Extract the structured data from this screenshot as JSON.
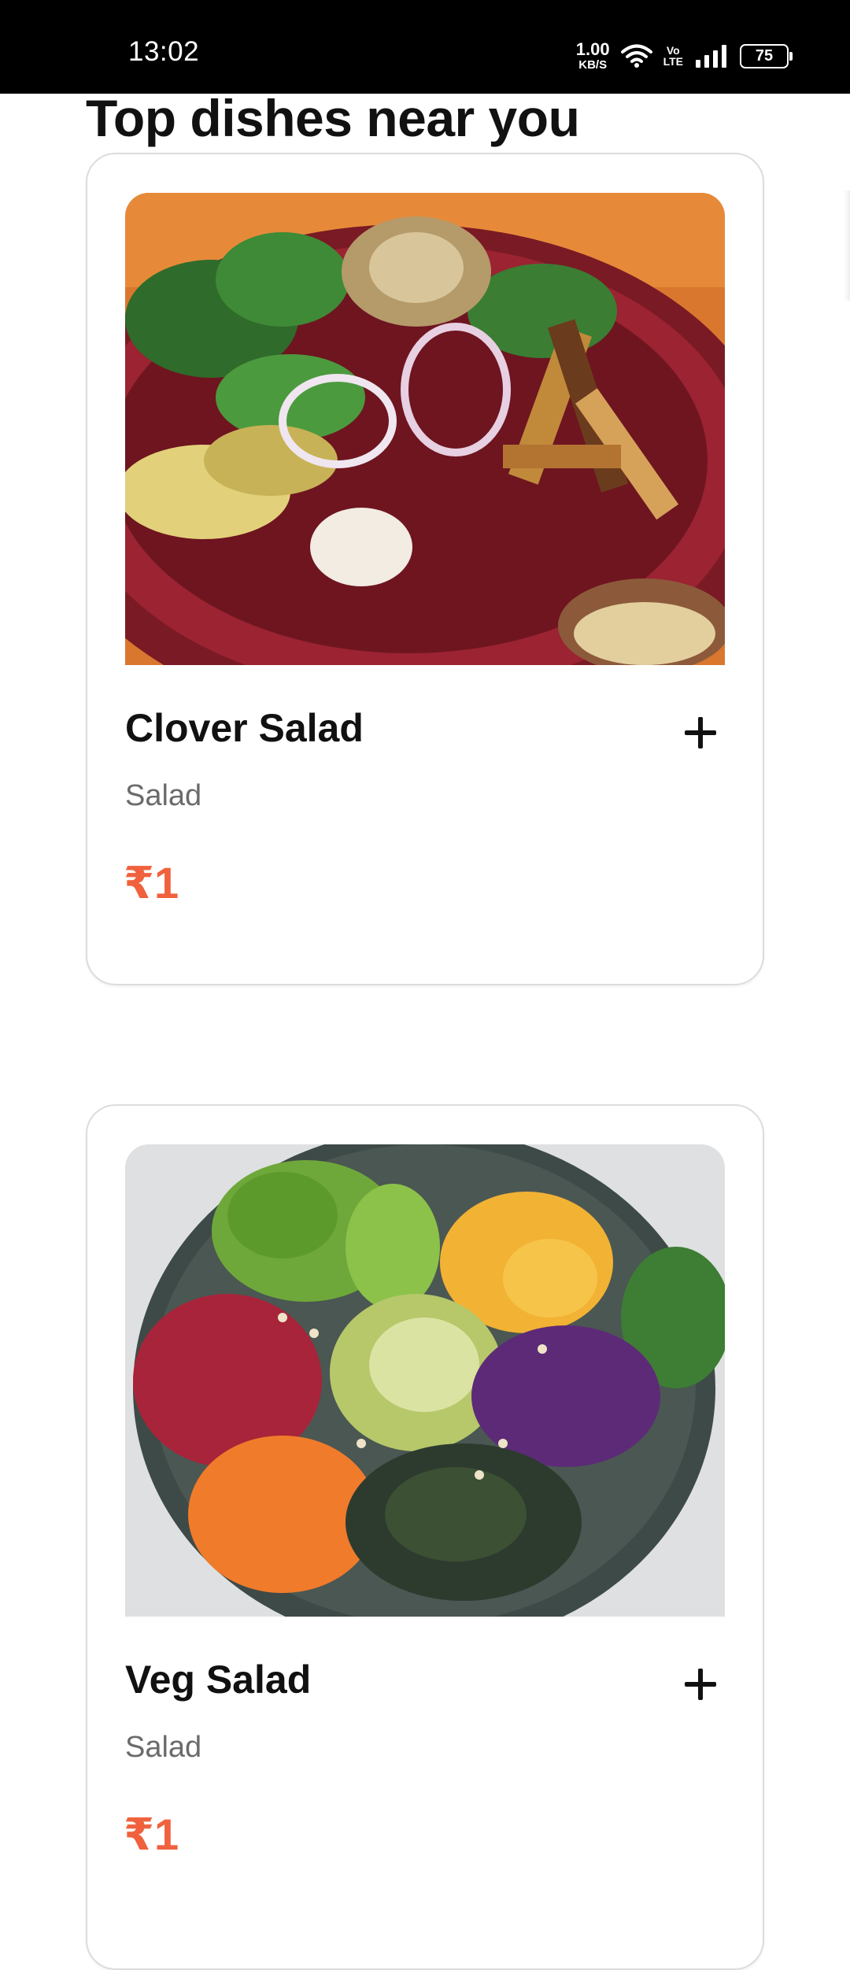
{
  "status_bar": {
    "time": "13:02",
    "net_speed_value": "1.00",
    "net_speed_unit": "KB/S",
    "volte_top": "Vo",
    "volte_bottom": "LTE",
    "battery": "75",
    "icons": [
      "wifi-icon",
      "volte-icon",
      "signal-icon",
      "battery-icon"
    ]
  },
  "section": {
    "title": "Top dishes near you"
  },
  "dishes": [
    {
      "name": "Clover Salad",
      "category": "Salad",
      "price": "₹1",
      "image": "clover-salad-photo",
      "add_icon": "plus-icon"
    },
    {
      "name": "Veg Salad",
      "category": "Salad",
      "price": "₹1",
      "image": "veg-salad-photo",
      "add_icon": "plus-icon"
    }
  ],
  "colors": {
    "price": "#f0613e",
    "status_bar": "#000000",
    "card_border": "#dcdcdc",
    "category_text": "#6b6b6b"
  }
}
